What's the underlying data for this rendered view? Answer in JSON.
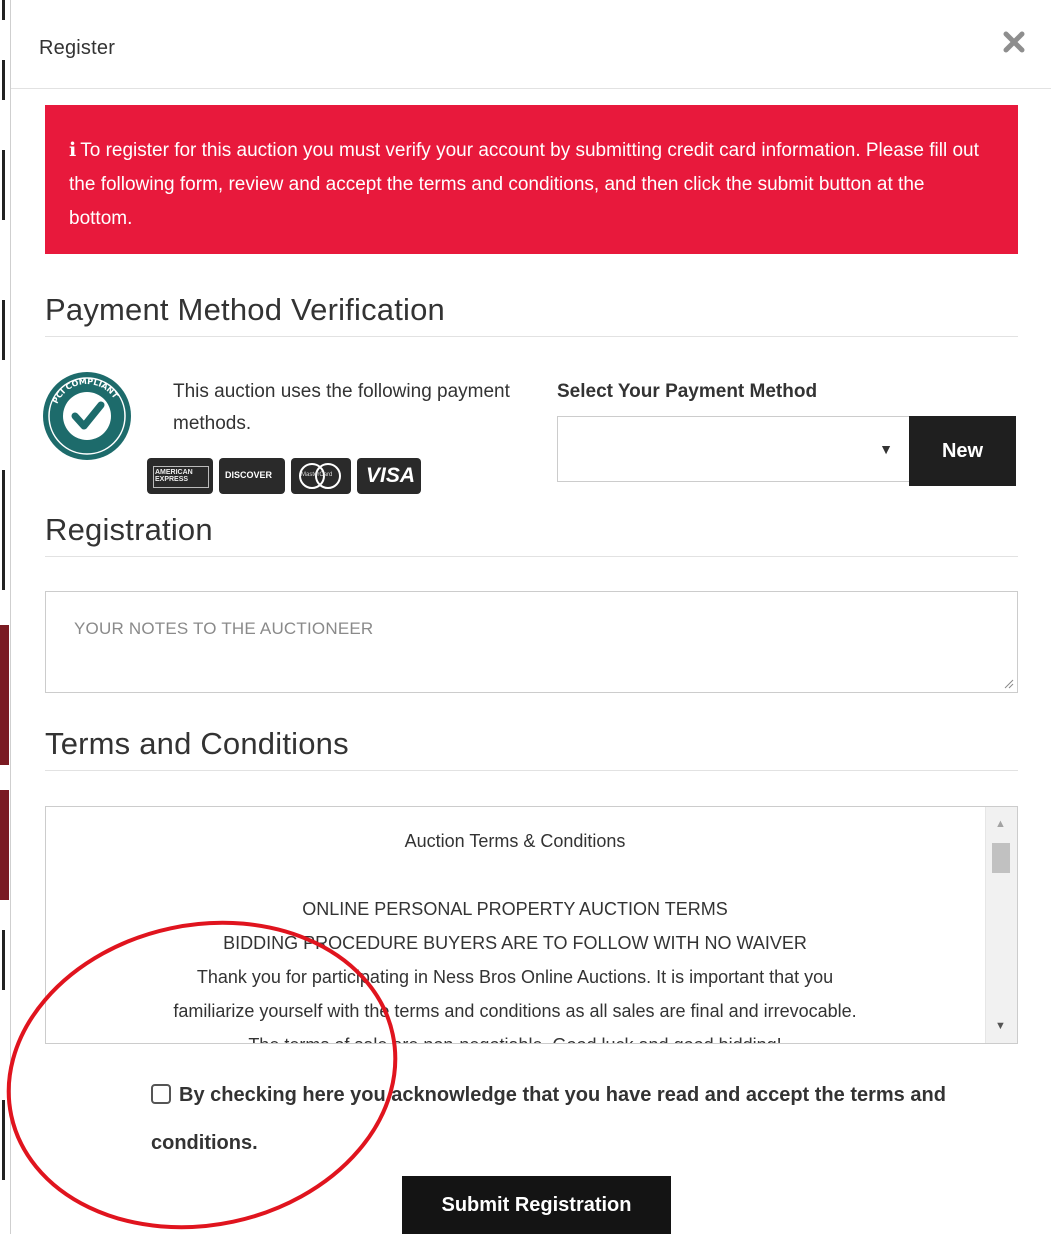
{
  "modal": {
    "title": "Register",
    "close_icon": "close-icon"
  },
  "alert": {
    "icon": "info-icon",
    "text": "To register for this auction you must verify your account by submitting credit card information. Please fill out the following form, review and accept the terms and conditions, and then click the submit button at the bottom.",
    "background": "#e8193c"
  },
  "payment": {
    "heading": "Payment Method Verification",
    "badge_icon": "pci-compliant-icon",
    "badge_text": "PCI COMPLIANT",
    "methods_text": "This auction uses the following payment methods.",
    "card_logos": [
      {
        "name": "american-express-icon",
        "label": "AMERICAN EXPRESS"
      },
      {
        "name": "discover-icon",
        "label": "DISCOVER"
      },
      {
        "name": "mastercard-icon",
        "label": "MasterCard"
      },
      {
        "name": "visa-icon",
        "label": "VISA"
      }
    ],
    "select_label": "Select Your Payment Method",
    "select_value": "",
    "new_button": "New"
  },
  "registration": {
    "heading": "Registration",
    "notes_placeholder": "YOUR NOTES TO THE AUCTIONEER"
  },
  "terms": {
    "heading": "Terms and Conditions",
    "lines": [
      "Auction Terms & Conditions",
      "",
      "ONLINE PERSONAL PROPERTY AUCTION TERMS",
      "BIDDING PROCEDURE BUYERS ARE TO FOLLOW WITH NO WAIVER",
      "Thank you for participating in Ness Bros Online Auctions. It is important that you",
      "familiarize yourself with the terms and conditions as all sales are final and irrevocable.",
      "The terms of sale are non-negotiable. Good luck and good bidding!"
    ],
    "accept_text": "By checking here you acknowledge that you have read and accept the terms and conditions.",
    "accept_checked": false
  },
  "submit_button": "Submit Registration",
  "colors": {
    "alert": "#e8193c",
    "button_dark": "#1f1f1f",
    "annotation": "#e0141e"
  }
}
